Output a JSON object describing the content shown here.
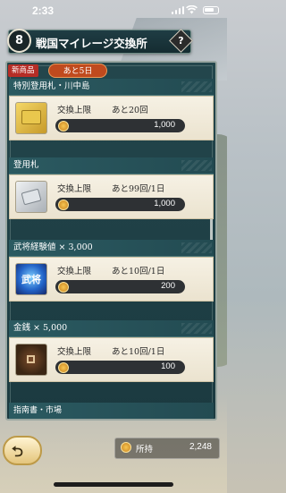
{
  "status_bar": {
    "time": "2:33"
  },
  "header": {
    "title": "戦国マイレージ交換所",
    "emblem_glyph": "8",
    "help_glyph": "?"
  },
  "badges": {
    "new_label": "新商品",
    "remaining_label": "あと5日"
  },
  "items": [
    {
      "name": "特別登用札・川中島",
      "limit_label": "交換上限",
      "limit_value": "あと20回",
      "price": "1,000",
      "thumb": "gold-ticket"
    },
    {
      "name": "登用札",
      "limit_label": "交換上限",
      "limit_value": "あと99回/1日",
      "price": "1,000",
      "thumb": "silver-ticket"
    },
    {
      "name": "武将経験値 × 3,000",
      "limit_label": "交換上限",
      "limit_value": "あと10回/1日",
      "price": "200",
      "thumb": "experience-orb",
      "thumb_text": "武将"
    },
    {
      "name": "金銭 × 5,000",
      "limit_label": "交換上限",
      "limit_value": "あと10回/1日",
      "price": "100",
      "thumb": "coin"
    }
  ],
  "next_item": {
    "name": "指南書・市場"
  },
  "footer": {
    "holding_label": "所持",
    "holding_value": "2,248"
  },
  "colors": {
    "panel": "#1f4147",
    "card": "#f3eddc",
    "price_bar": "#2e3134",
    "badge_red": "#b52d26",
    "badge_orange": "#c04a1e"
  }
}
